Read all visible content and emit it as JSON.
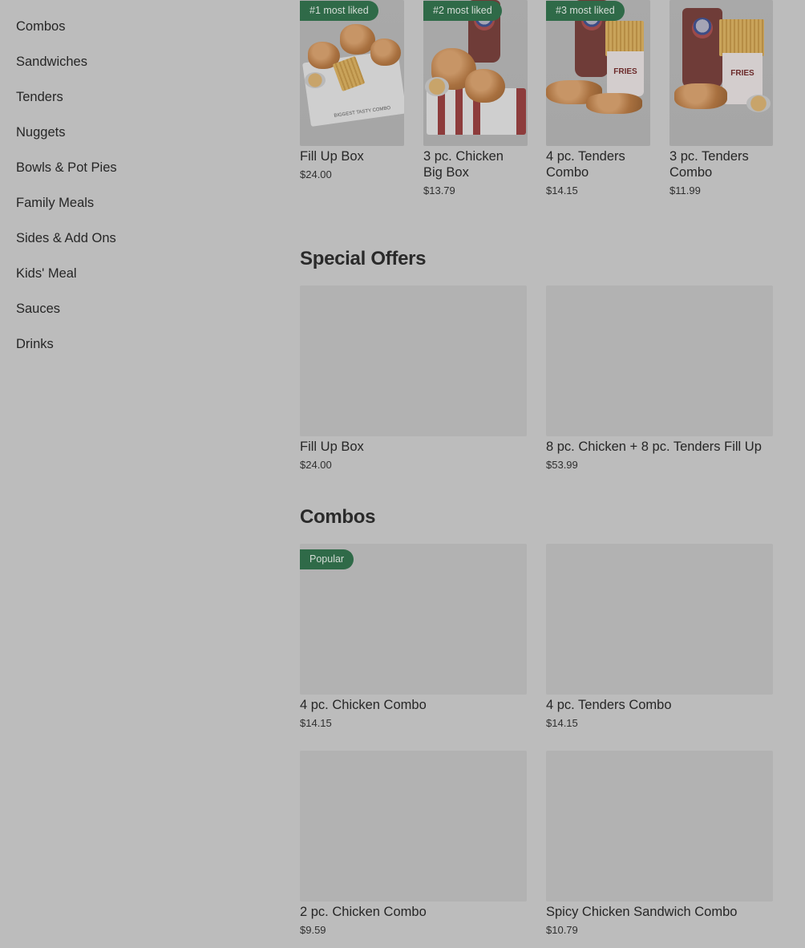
{
  "sidebar": {
    "items": [
      {
        "label": "Combos"
      },
      {
        "label": "Sandwiches"
      },
      {
        "label": "Tenders"
      },
      {
        "label": "Nuggets"
      },
      {
        "label": "Bowls & Pot Pies"
      },
      {
        "label": "Family Meals"
      },
      {
        "label": "Sides & Add Ons"
      },
      {
        "label": "Kids' Meal"
      },
      {
        "label": "Sauces"
      },
      {
        "label": "Drinks"
      }
    ]
  },
  "most_liked": [
    {
      "badge": "#1 most liked",
      "name": "Fill Up Box",
      "price": "$24.00"
    },
    {
      "badge": "#2 most liked",
      "name": "3 pc. Chicken Big Box",
      "price": "$13.79"
    },
    {
      "badge": "#3 most liked",
      "name": "4 pc. Tenders Combo",
      "price": "$14.15"
    },
    {
      "badge": "",
      "name": "3 pc. Tenders Combo",
      "price": "$11.99"
    }
  ],
  "special_offers": {
    "title": "Special Offers",
    "items": [
      {
        "name": "Fill Up Box",
        "price": "$24.00"
      },
      {
        "name": "8 pc. Chicken + 8 pc. Tenders Fill Up",
        "price": "$53.99"
      }
    ]
  },
  "combos": {
    "title": "Combos",
    "items": [
      {
        "badge": "Popular",
        "name": "4 pc. Chicken Combo",
        "price": "$14.15"
      },
      {
        "badge": "",
        "name": "4 pc. Tenders Combo",
        "price": "$14.15"
      },
      {
        "badge": "",
        "name": "2 pc. Chicken Combo",
        "price": "$9.59"
      },
      {
        "badge": "",
        "name": "Spicy Chicken Sandwich Combo",
        "price": "$10.79"
      }
    ]
  },
  "product_art": {
    "fries_label": "FRIES",
    "cup_brand": "pepsi",
    "box_print": "BIGGEST TASTY COMBO"
  },
  "colors": {
    "overlay_background": "#bcbcbc",
    "badge_green": "#2f6a48",
    "image_placeholder": "#b2b2b2"
  }
}
